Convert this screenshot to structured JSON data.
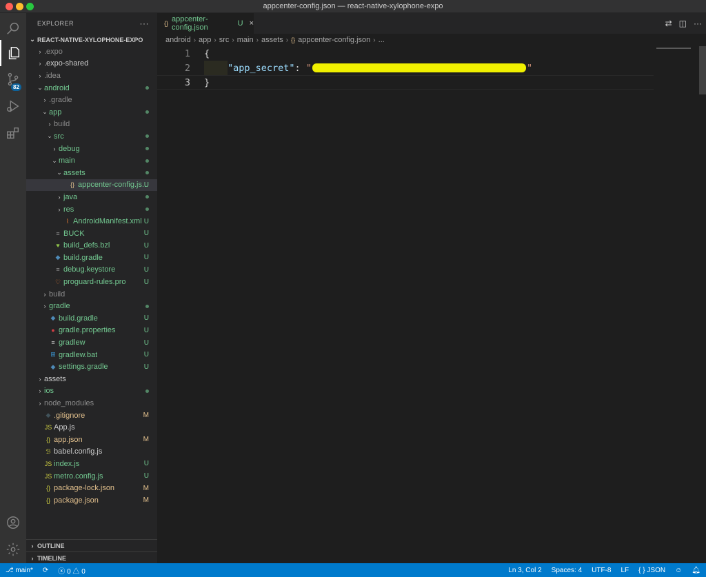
{
  "window": {
    "title": "appcenter-config.json — react-native-xylophone-expo"
  },
  "activity": {
    "source_control_badge": "82"
  },
  "sidebar": {
    "header": "EXPLORER",
    "more": "···",
    "project": "REACT-NATIVE-XYLOPHONE-EXPO",
    "outline": "OUTLINE",
    "timeline": "TIMELINE",
    "items": [
      {
        "label": ".expo",
        "depth": 0,
        "type": "folder",
        "open": false,
        "color": "grey",
        "deco": ""
      },
      {
        "label": ".expo-shared",
        "depth": 0,
        "type": "folder",
        "open": false,
        "color": "white",
        "deco": ""
      },
      {
        "label": ".idea",
        "depth": 0,
        "type": "folder",
        "open": false,
        "color": "grey",
        "deco": ""
      },
      {
        "label": "android",
        "depth": 0,
        "type": "folder",
        "open": true,
        "color": "green",
        "deco": "dot"
      },
      {
        "label": ".gradle",
        "depth": 1,
        "type": "folder",
        "open": false,
        "color": "grey",
        "deco": ""
      },
      {
        "label": "app",
        "depth": 1,
        "type": "folder",
        "open": true,
        "color": "green",
        "deco": "dot"
      },
      {
        "label": "build",
        "depth": 2,
        "type": "folder",
        "open": false,
        "color": "grey",
        "deco": ""
      },
      {
        "label": "src",
        "depth": 2,
        "type": "folder",
        "open": true,
        "color": "green",
        "deco": "dot"
      },
      {
        "label": "debug",
        "depth": 3,
        "type": "folder",
        "open": false,
        "color": "green",
        "deco": "dot"
      },
      {
        "label": "main",
        "depth": 3,
        "type": "folder",
        "open": true,
        "color": "green",
        "deco": "dot"
      },
      {
        "label": "assets",
        "depth": 4,
        "type": "folder",
        "open": true,
        "color": "green",
        "deco": "dot"
      },
      {
        "label": "appcenter-config.js...",
        "depth": 5,
        "type": "file",
        "icon": "{}",
        "iconColor": "#e2c08d",
        "color": "green",
        "deco": "U",
        "selected": true
      },
      {
        "label": "java",
        "depth": 4,
        "type": "folder",
        "open": false,
        "color": "green",
        "deco": "dot"
      },
      {
        "label": "res",
        "depth": 4,
        "type": "folder",
        "open": false,
        "color": "green",
        "deco": "dot"
      },
      {
        "label": "AndroidManifest.xml",
        "depth": 4,
        "type": "file",
        "icon": "⌇",
        "iconColor": "#e37933",
        "color": "green",
        "deco": "U"
      },
      {
        "label": "BUCK",
        "depth": 2,
        "type": "file",
        "icon": "≡",
        "iconColor": "#8c8c8c",
        "color": "green",
        "deco": "U"
      },
      {
        "label": "build_defs.bzl",
        "depth": 2,
        "type": "file",
        "icon": "♥",
        "iconColor": "#8dc149",
        "color": "green",
        "deco": "U"
      },
      {
        "label": "build.gradle",
        "depth": 2,
        "type": "file",
        "icon": "◆",
        "iconColor": "#4e8bb8",
        "color": "green",
        "deco": "U"
      },
      {
        "label": "debug.keystore",
        "depth": 2,
        "type": "file",
        "icon": "≡",
        "iconColor": "#8c8c8c",
        "color": "green",
        "deco": "U"
      },
      {
        "label": "proguard-rules.pro",
        "depth": 2,
        "type": "file",
        "icon": "♡",
        "iconColor": "#e37933",
        "color": "green",
        "deco": "U"
      },
      {
        "label": "build",
        "depth": 1,
        "type": "folder",
        "open": false,
        "color": "grey",
        "deco": ""
      },
      {
        "label": "gradle",
        "depth": 1,
        "type": "folder",
        "open": false,
        "color": "green",
        "deco": "dot"
      },
      {
        "label": "build.gradle",
        "depth": 1,
        "type": "file",
        "icon": "◆",
        "iconColor": "#4e8bb8",
        "color": "green",
        "deco": "U"
      },
      {
        "label": "gradle.properties",
        "depth": 1,
        "type": "file",
        "icon": "●",
        "iconColor": "#cc3e44",
        "color": "green",
        "deco": "U"
      },
      {
        "label": "gradlew",
        "depth": 1,
        "type": "file",
        "icon": "≡",
        "iconColor": "#cccccc",
        "color": "green",
        "deco": "U"
      },
      {
        "label": "gradlew.bat",
        "depth": 1,
        "type": "file",
        "icon": "⊞",
        "iconColor": "#3a9ad9",
        "color": "green",
        "deco": "U"
      },
      {
        "label": "settings.gradle",
        "depth": 1,
        "type": "file",
        "icon": "◆",
        "iconColor": "#4e8bb8",
        "color": "green",
        "deco": "U"
      },
      {
        "label": "assets",
        "depth": 0,
        "type": "folder",
        "open": false,
        "color": "white",
        "deco": ""
      },
      {
        "label": "ios",
        "depth": 0,
        "type": "folder",
        "open": false,
        "color": "green",
        "deco": "dot"
      },
      {
        "label": "node_modules",
        "depth": 0,
        "type": "folder",
        "open": false,
        "color": "grey",
        "deco": ""
      },
      {
        "label": ".gitignore",
        "depth": 0,
        "type": "file",
        "icon": "◆",
        "iconColor": "#41535b",
        "color": "yellow",
        "deco": "M"
      },
      {
        "label": "App.js",
        "depth": 0,
        "type": "file",
        "icon": "JS",
        "iconColor": "#cbcb41",
        "color": "white",
        "deco": ""
      },
      {
        "label": "app.json",
        "depth": 0,
        "type": "file",
        "icon": "{}",
        "iconColor": "#cbcb41",
        "color": "yellow",
        "deco": "M"
      },
      {
        "label": "babel.config.js",
        "depth": 0,
        "type": "file",
        "icon": "ℬ",
        "iconColor": "#cbcb41",
        "color": "white",
        "deco": ""
      },
      {
        "label": "index.js",
        "depth": 0,
        "type": "file",
        "icon": "JS",
        "iconColor": "#cbcb41",
        "color": "green",
        "deco": "U"
      },
      {
        "label": "metro.config.js",
        "depth": 0,
        "type": "file",
        "icon": "JS",
        "iconColor": "#cbcb41",
        "color": "green",
        "deco": "U"
      },
      {
        "label": "package-lock.json",
        "depth": 0,
        "type": "file",
        "icon": "{}",
        "iconColor": "#cbcb41",
        "color": "yellow",
        "deco": "M"
      },
      {
        "label": "package.json",
        "depth": 0,
        "type": "file",
        "icon": "{}",
        "iconColor": "#cbcb41",
        "color": "yellow",
        "deco": "M"
      }
    ]
  },
  "editor": {
    "tab": {
      "name": "appcenter-config.json",
      "deco": "U",
      "icon": "{}"
    },
    "breadcrumb": [
      "android",
      "app",
      "src",
      "main",
      "assets",
      "appcenter-config.json",
      "..."
    ],
    "lines": [
      {
        "num": "1",
        "text": "{"
      },
      {
        "num": "2",
        "key": "\"app_secret\"",
        "colon": ": ",
        "quote_open": "\"",
        "quote_close": "\""
      },
      {
        "num": "3",
        "text": "}"
      }
    ]
  },
  "statusbar": {
    "branch": "main*",
    "errors": "0",
    "warnings": "0",
    "position": "Ln 3, Col 2",
    "spaces": "Spaces: 4",
    "encoding": "UTF-8",
    "eol": "LF",
    "language": "JSON",
    "lang_icon": "{ }"
  }
}
